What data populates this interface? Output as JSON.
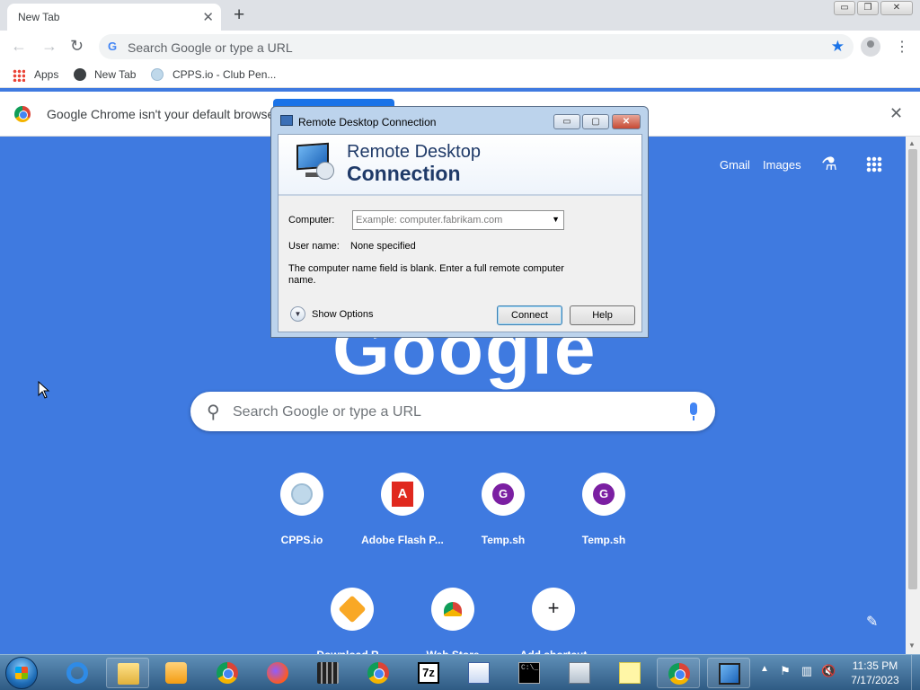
{
  "browser": {
    "tab_title": "New Tab",
    "tab_close": "✕",
    "new_tab": "+",
    "window_controls": {
      "minimize": "▭",
      "restore": "❐",
      "close": "✕"
    },
    "omnibox_placeholder": "Search Google or type a URL",
    "omnibox_g": "G",
    "star": "★",
    "menu": "⋮",
    "nav": {
      "back": "←",
      "forward": "→",
      "reload": "↻"
    },
    "bookmarks": [
      {
        "label": "Apps",
        "icon": "apps-grid-icon"
      },
      {
        "label": "New Tab",
        "icon": "globe-icon"
      },
      {
        "label": "CPPS.io - Club Pen...",
        "icon": "cpps-icon"
      }
    ],
    "infobar": {
      "text": "Google Chrome isn't your default browser",
      "close": "✕"
    }
  },
  "ntp": {
    "gmail": "Gmail",
    "images": "Images",
    "logo": "Google",
    "search_placeholder": "Search Google or type a URL",
    "search_icon": "⚲",
    "labs_icon": "⚗",
    "pencil": "✎",
    "shortcuts_row1": [
      {
        "label": "CPPS.io",
        "icon": "cpps-icon"
      },
      {
        "label": "Adobe Flash P...",
        "icon": "adobe-icon",
        "badge": "A"
      },
      {
        "label": "Temp.sh",
        "icon": "g-icon",
        "badge": "G"
      },
      {
        "label": "Temp.sh",
        "icon": "g-icon",
        "badge": "G"
      }
    ],
    "shortcuts_row2": [
      {
        "label": "Download R...",
        "icon": "rd-icon"
      },
      {
        "label": "Web Store",
        "icon": "webstore-icon"
      },
      {
        "label": "Add shortcut",
        "icon": "plus-icon",
        "badge": "+"
      }
    ]
  },
  "rdc": {
    "window_title": "Remote Desktop Connection",
    "controls": {
      "minimize": "▭",
      "maximize": "▢",
      "close": "✕"
    },
    "banner_line1": "Remote Desktop",
    "banner_line2": "Connection",
    "computer_label": "Computer:",
    "computer_placeholder": "Example: computer.fabrikam.com",
    "combo_arrow": "▼",
    "username_label": "User name:",
    "username_value": "None specified",
    "message": "The computer name field is blank. Enter a full remote computer name.",
    "options_icon": "▼",
    "show_options": "Show Options",
    "connect": "Connect",
    "help": "Help"
  },
  "taskbar": {
    "items": [
      {
        "name": "internet-explorer-icon",
        "pinned": false
      },
      {
        "name": "file-explorer-icon",
        "pinned": true
      },
      {
        "name": "media-player-icon",
        "pinned": false
      },
      {
        "name": "chrome-icon",
        "pinned": false
      },
      {
        "name": "firefox-icon",
        "pinned": false
      },
      {
        "name": "movie-maker-icon",
        "pinned": false
      },
      {
        "name": "chrome-icon",
        "pinned": false
      },
      {
        "name": "7zip-icon",
        "pinned": false,
        "label": "7z"
      },
      {
        "name": "window-app-icon",
        "pinned": false
      },
      {
        "name": "command-prompt-icon",
        "pinned": false,
        "label": "C:\\_"
      },
      {
        "name": "calculator-icon",
        "pinned": false
      },
      {
        "name": "sticky-notes-icon",
        "pinned": false
      },
      {
        "name": "chrome-icon",
        "pinned": true
      },
      {
        "name": "remote-desktop-icon",
        "pinned": true
      }
    ],
    "tray": {
      "arrow": "▲",
      "flag": "⚑",
      "network": "▥",
      "volume": "🔇"
    },
    "time": "11:35 PM",
    "date": "7/17/2023"
  }
}
